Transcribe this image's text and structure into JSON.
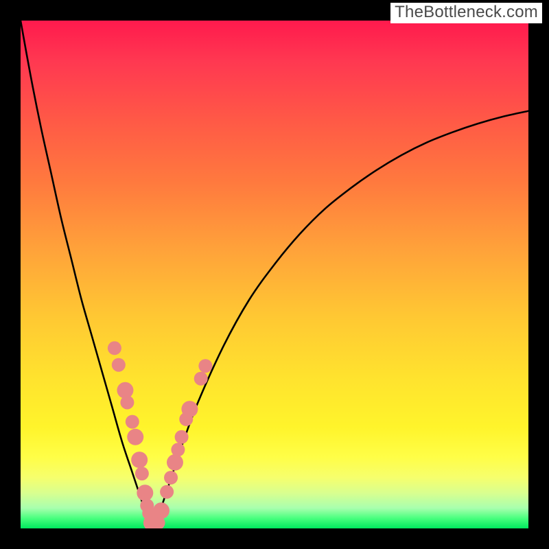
{
  "watermark": "TheBottleneck.com",
  "colors": {
    "frame": "#000000",
    "curve": "#000000",
    "marker_fill": "#e98486",
    "marker_stroke": "#d86f71"
  },
  "chart_data": {
    "type": "line",
    "title": "",
    "xlabel": "",
    "ylabel": "",
    "xlim": [
      0,
      100
    ],
    "ylim": [
      0,
      100
    ],
    "note": "V-shaped bottleneck curve. y expressed as percent of plot height from top (0=top,100=bottom). Minimum near x≈26.",
    "series": [
      {
        "name": "bottleneck-curve",
        "x": [
          0,
          2,
          4,
          6,
          8,
          10,
          12,
          14,
          16,
          18,
          20,
          22,
          24,
          25,
          26,
          27,
          28,
          30,
          32,
          35,
          40,
          45,
          50,
          55,
          60,
          65,
          70,
          75,
          80,
          85,
          90,
          95,
          100
        ],
        "y": [
          0,
          11,
          21,
          30,
          39,
          47,
          55,
          62,
          69,
          76,
          83,
          89,
          95,
          98,
          100,
          98,
          95,
          89,
          83,
          75,
          64,
          55,
          48,
          42,
          37,
          33,
          29.5,
          26.5,
          24,
          22,
          20.3,
          18.9,
          17.8
        ]
      }
    ],
    "markers": {
      "name": "highlighted-points",
      "note": "salmon dots clustered around the valley on both branches",
      "points": [
        {
          "x": 18.5,
          "y": 64.5,
          "r": 10
        },
        {
          "x": 19.3,
          "y": 67.8,
          "r": 10
        },
        {
          "x": 20.6,
          "y": 72.8,
          "r": 12
        },
        {
          "x": 21.0,
          "y": 75.2,
          "r": 10
        },
        {
          "x": 22.0,
          "y": 79.0,
          "r": 10
        },
        {
          "x": 22.6,
          "y": 82.0,
          "r": 12
        },
        {
          "x": 23.4,
          "y": 86.5,
          "r": 12
        },
        {
          "x": 23.9,
          "y": 89.2,
          "r": 10
        },
        {
          "x": 24.5,
          "y": 93.0,
          "r": 12
        },
        {
          "x": 24.9,
          "y": 95.5,
          "r": 10
        },
        {
          "x": 25.3,
          "y": 97.0,
          "r": 10
        },
        {
          "x": 25.8,
          "y": 98.9,
          "r": 12
        },
        {
          "x": 26.5,
          "y": 98.9,
          "r": 12
        },
        {
          "x": 27.1,
          "y": 98.9,
          "r": 10
        },
        {
          "x": 27.7,
          "y": 96.5,
          "r": 12
        },
        {
          "x": 28.8,
          "y": 92.8,
          "r": 10
        },
        {
          "x": 29.6,
          "y": 90.0,
          "r": 10
        },
        {
          "x": 30.4,
          "y": 87.0,
          "r": 12
        },
        {
          "x": 31.0,
          "y": 84.5,
          "r": 10
        },
        {
          "x": 31.7,
          "y": 82.0,
          "r": 10
        },
        {
          "x": 32.6,
          "y": 78.5,
          "r": 10
        },
        {
          "x": 33.3,
          "y": 76.5,
          "r": 12
        },
        {
          "x": 35.5,
          "y": 70.5,
          "r": 10
        },
        {
          "x": 36.4,
          "y": 68.0,
          "r": 10
        }
      ]
    }
  }
}
